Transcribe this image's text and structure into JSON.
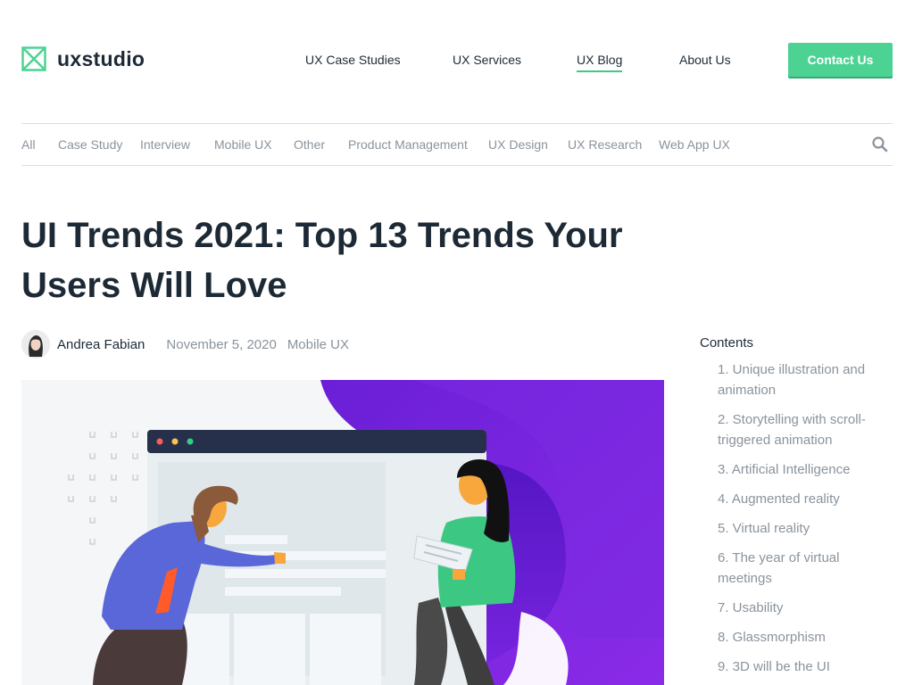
{
  "brand": {
    "name": "uxstudio",
    "accent": "#4cd394"
  },
  "nav": {
    "items": [
      {
        "label": "UX Case Studies",
        "active": false
      },
      {
        "label": "UX Services",
        "active": false
      },
      {
        "label": "UX Blog",
        "active": true
      },
      {
        "label": "About Us",
        "active": false
      }
    ],
    "cta": "Contact Us"
  },
  "categories": {
    "items": [
      "All",
      "Case Study",
      "Interview",
      "Mobile UX",
      "Other",
      "Product Management",
      "UX Design",
      "UX Research",
      "Web App UX"
    ],
    "search_icon": "search-icon"
  },
  "article": {
    "title": "UI Trends 2021: Top 13 Trends Your Users Will Love",
    "author": "Andrea Fabian",
    "date": "November 5, 2020",
    "category": "Mobile UX"
  },
  "contents": {
    "title": "Contents",
    "items": [
      "1. Unique illustration and animation",
      "2. Storytelling with scroll-triggered animation",
      "3. Artificial Intelligence",
      "4. Augmented reality",
      "5. Virtual reality",
      "6. The year of virtual meetings",
      "7. Usability",
      "8. Glassmorphism",
      "9. 3D will be the UI"
    ]
  }
}
